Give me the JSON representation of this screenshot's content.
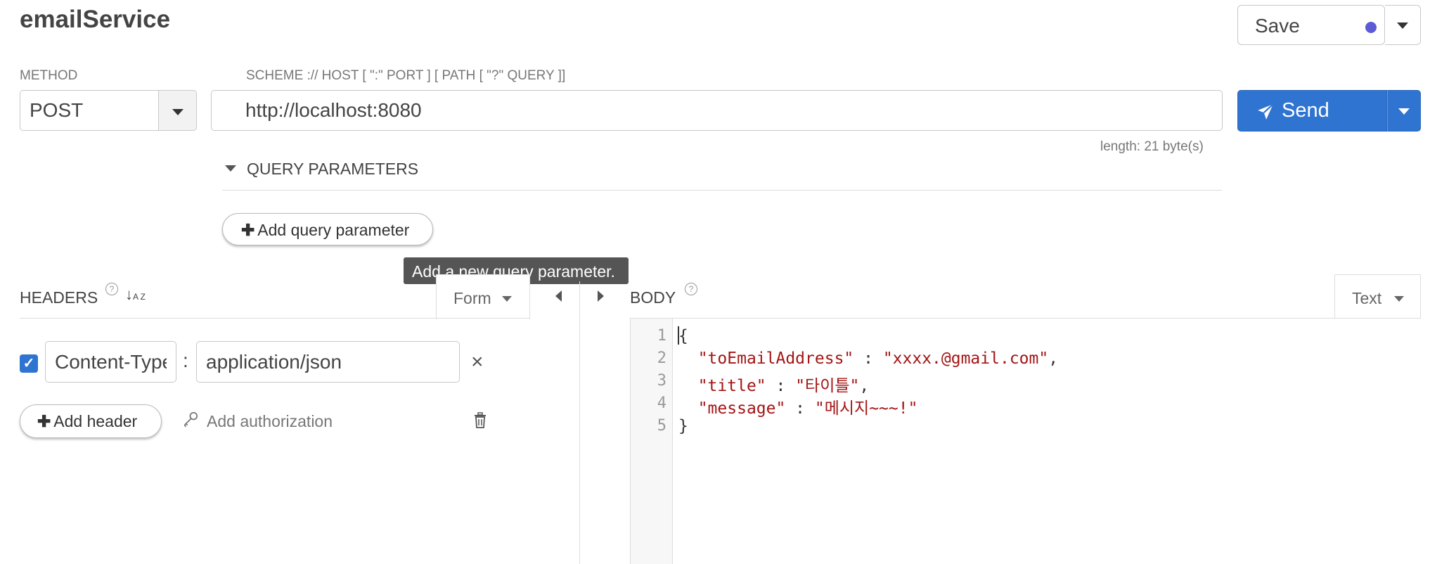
{
  "request": {
    "title": "emailService",
    "method_label": "METHOD",
    "method_value": "POST",
    "url_label": "SCHEME :// HOST [ \":\" PORT ] [ PATH [ \"?\" QUERY ]]",
    "url_value": "http://localhost:8080",
    "length_text": "length: 21 byte(s)"
  },
  "toolbar": {
    "save_label": "Save",
    "save_dot_color": "#5b5bd6",
    "send_label": "Send",
    "send_color": "#2f74d0"
  },
  "query": {
    "section_label": "QUERY PARAMETERS",
    "add_label": "Add query parameter",
    "tooltip": "Add a new query parameter."
  },
  "headers": {
    "section_label": "HEADERS",
    "mode_label": "Form",
    "rows": [
      {
        "enabled": true,
        "name": "Content-Type",
        "value": "application/json"
      }
    ],
    "add_header_label": "Add header",
    "add_auth_label": "Add authorization"
  },
  "body": {
    "section_label": "BODY",
    "mode_label": "Text",
    "lines": [
      {
        "num": "1",
        "text": "{"
      },
      {
        "num": "2",
        "key": "\"toEmailAddress\"",
        "sep": " : ",
        "val": "\"xxxx.@gmail.com\"",
        "tail": ","
      },
      {
        "num": "3",
        "key": "\"title\"",
        "sep": " : ",
        "val": "\"타이틀\"",
        "tail": ","
      },
      {
        "num": "4",
        "key": "\"message\"",
        "sep": " : ",
        "val": "\"메시지~~~!\"",
        "tail": ""
      },
      {
        "num": "5",
        "text": "}"
      }
    ]
  }
}
